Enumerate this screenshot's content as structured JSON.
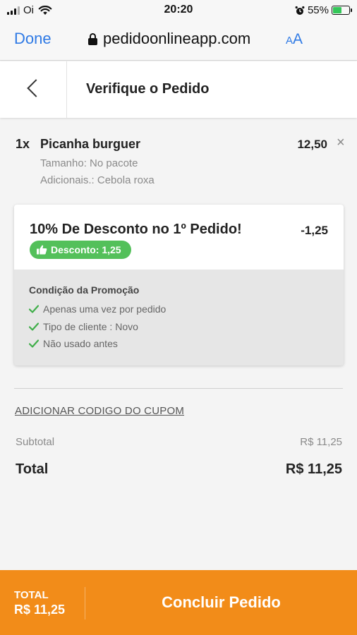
{
  "status_bar": {
    "carrier": "Oi",
    "time": "20:20",
    "battery_pct": "55%",
    "battery_level": 0.55,
    "icons": [
      "signal-icon",
      "wifi-icon",
      "alarm-icon",
      "battery-icon"
    ]
  },
  "browser": {
    "done_label": "Done",
    "url": "pedidoonlineapp.com",
    "aa_small": "A",
    "aa_big": "A"
  },
  "header": {
    "title": "Verifique o Pedido"
  },
  "item": {
    "qty": "1x",
    "name": "Picanha burguer",
    "price": "12,50",
    "remove": "×",
    "details": [
      "Tamanho: No pacote",
      "Adicionais.: Cebola roxa"
    ]
  },
  "promo": {
    "title": "10% De Desconto no 1º Pedido!",
    "amount": "-1,25",
    "badge": "Desconto: 1,25",
    "conditions_title": "Condição da Promoção",
    "conditions": [
      "Apenas uma vez por pedido",
      "Tipo de cliente : Novo",
      "Não usado antes"
    ]
  },
  "summary": {
    "coupon_link": "ADICIONAR CODIGO DO CUPOM",
    "subtotal_label": "Subtotal",
    "subtotal_value": "R$ 11,25",
    "total_label": "Total",
    "total_value": "R$ 11,25"
  },
  "footer": {
    "total_label": "TOTAL",
    "total_value": "R$ 11,25",
    "checkout_label": "Concluir Pedido"
  },
  "colors": {
    "accent_orange": "#f28c19",
    "badge_green": "#53c05a",
    "ios_blue": "#2f7ae5",
    "check_green": "#3fae49"
  }
}
